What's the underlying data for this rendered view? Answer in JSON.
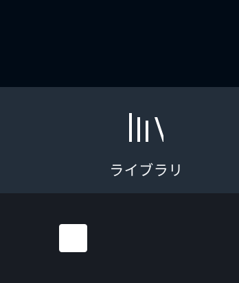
{
  "nav": {
    "library": {
      "icon": "library-icon",
      "label": "ライブラリ"
    }
  },
  "player": {
    "stop_icon": "stop-icon"
  },
  "colors": {
    "top_background": "#010b16",
    "nav_background": "#232e3a",
    "player_background": "#181c23",
    "foreground": "#f3f5f7"
  }
}
